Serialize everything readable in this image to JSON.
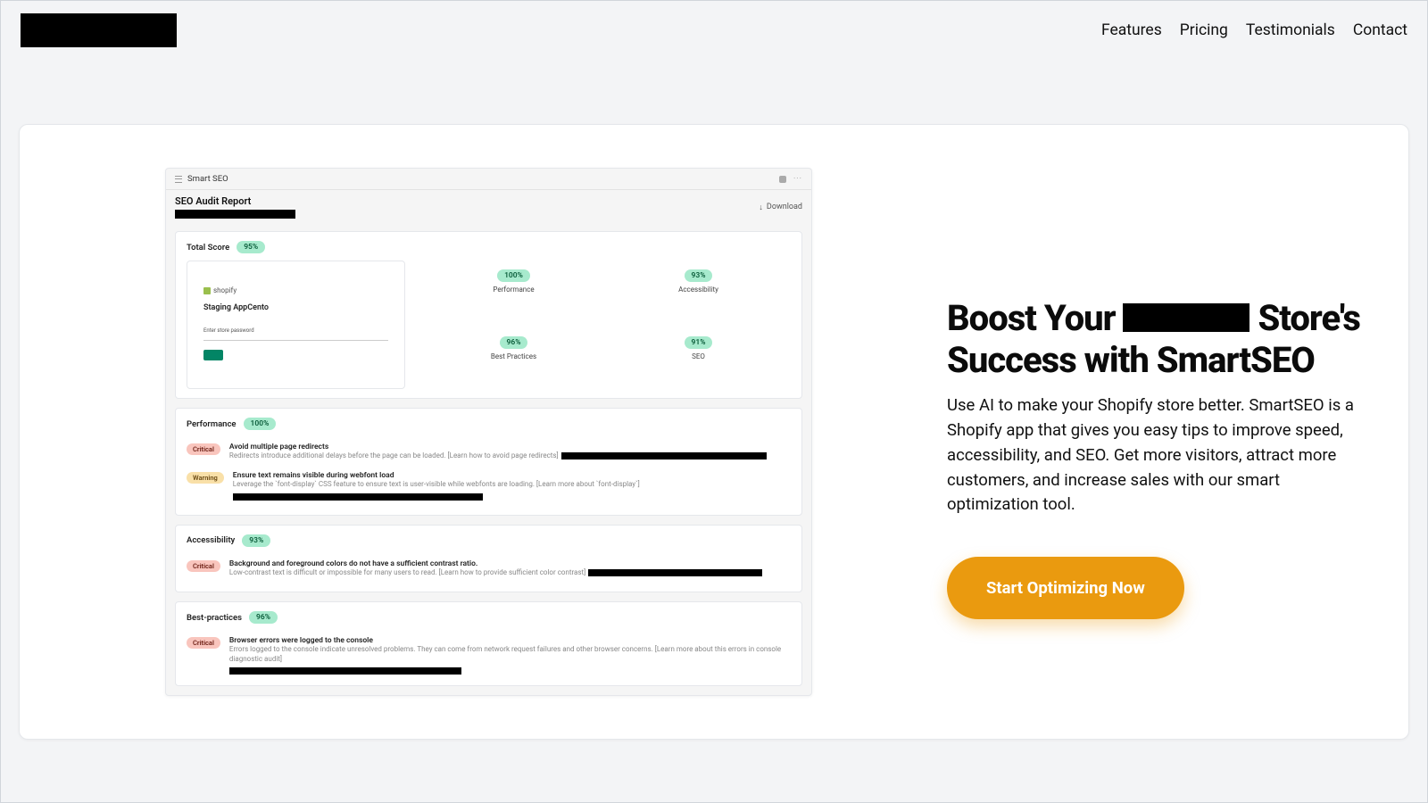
{
  "nav": {
    "features": "Features",
    "pricing": "Pricing",
    "testimonials": "Testimonials",
    "contact": "Contact"
  },
  "hero": {
    "title_pre": "Boost Your ",
    "title_post": " Store's Success with SmartSEO",
    "subtitle": "Use AI to make your Shopify store better. SmartSEO is a Shopify app that gives you easy tips to improve speed, accessibility, and SEO. Get more visitors, attract more customers, and increase sales with our smart optimization tool.",
    "cta": "Start Optimizing Now"
  },
  "app": {
    "brand": "Smart SEO",
    "report_title": "SEO Audit Report",
    "download": "Download",
    "total_score": {
      "label": "Total Score",
      "value": "95%"
    },
    "scores": {
      "performance": {
        "label": "Performance",
        "value": "100%"
      },
      "accessibility": {
        "label": "Accessibility",
        "value": "93%"
      },
      "best_practices": {
        "label": "Best Practices",
        "value": "96%"
      },
      "seo": {
        "label": "SEO",
        "value": "91%"
      }
    },
    "browser_mock": {
      "logo_label": "shopify",
      "title": "Staging AppCento",
      "password_label": "Enter store password"
    },
    "sections": {
      "performance": {
        "title": "Performance",
        "score": "100%",
        "issues": [
          {
            "severity": "Critical",
            "title": "Avoid multiple page redirects",
            "desc": "Redirects introduce additional delays before the page can be loaded. [Learn how to avoid page redirects]"
          },
          {
            "severity": "Warning",
            "title": "Ensure text remains visible during webfont load",
            "desc": "Leverage the `font-display` CSS feature to ensure text is user-visible while webfonts are loading. [Learn more about `font-display`]"
          }
        ]
      },
      "accessibility": {
        "title": "Accessibility",
        "score": "93%",
        "issues": [
          {
            "severity": "Critical",
            "title": "Background and foreground colors do not have a sufficient contrast ratio.",
            "desc": "Low-contrast text is difficult or impossible for many users to read. [Learn how to provide sufficient color contrast]"
          }
        ]
      },
      "best_practices": {
        "title": "Best-practices",
        "score": "96%",
        "issues": [
          {
            "severity": "Critical",
            "title": "Browser errors were logged to the console",
            "desc": "Errors logged to the console indicate unresolved problems. They can come from network request failures and other browser concerns. [Learn more about this errors in console diagnostic audit]"
          }
        ]
      }
    }
  }
}
